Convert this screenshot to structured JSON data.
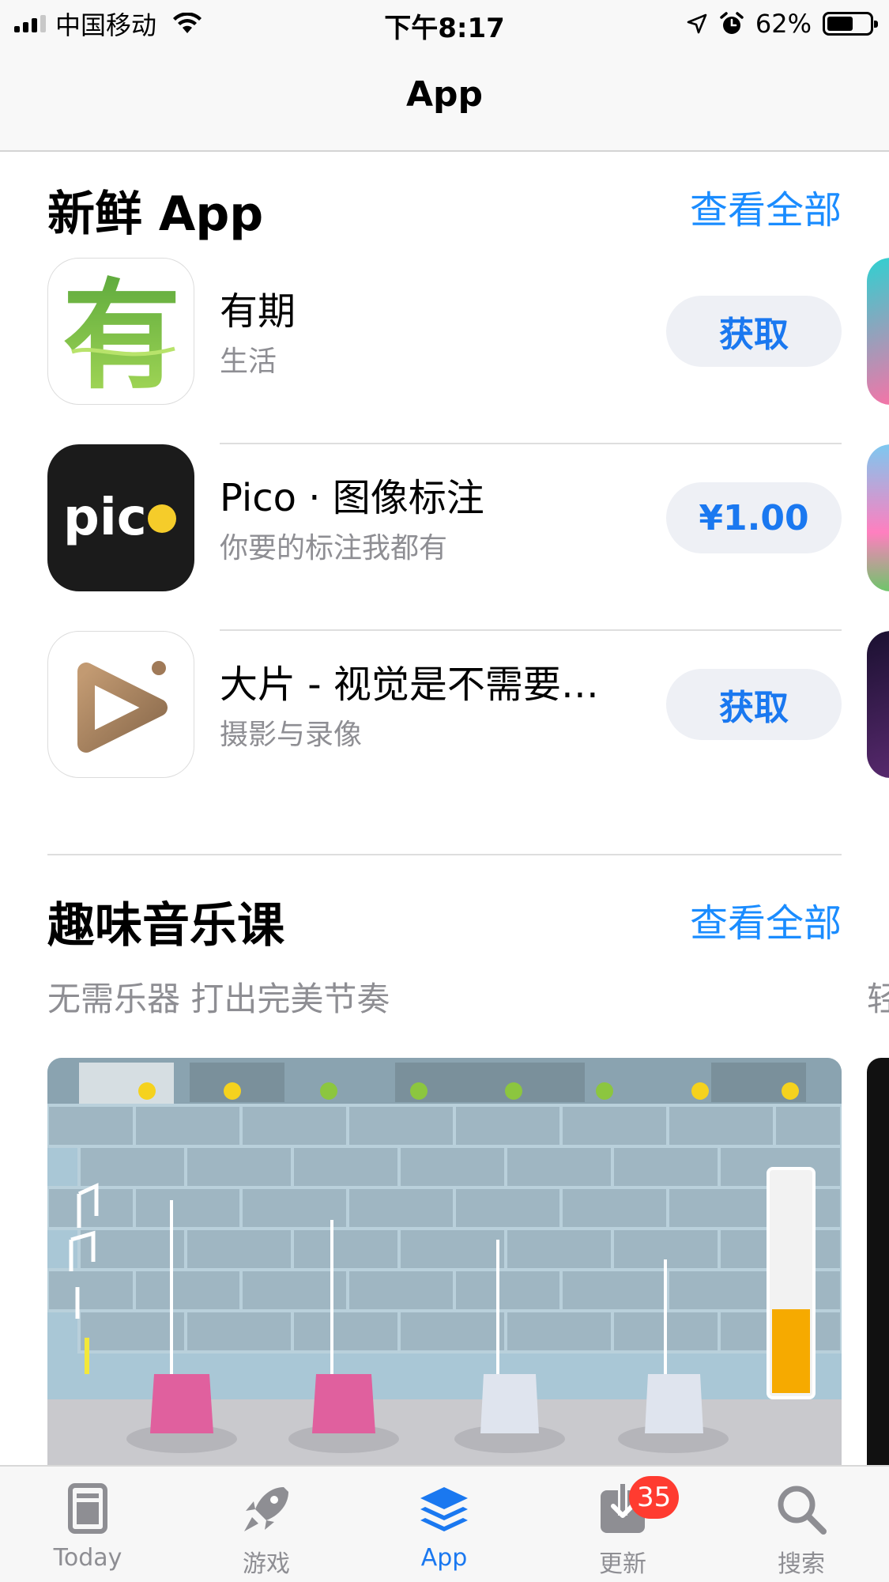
{
  "status_bar": {
    "carrier": "中国移动",
    "time": "下午8:17",
    "battery": "62%",
    "battery_level": 0.62
  },
  "nav": {
    "title": "App"
  },
  "section_new": {
    "title": "新鲜 App",
    "see_all": "查看全部",
    "apps": [
      {
        "name": "有期",
        "subtitle": "生活",
        "button": "获取",
        "icon_glyph": "有"
      },
      {
        "name": "Pico · 图像标注",
        "subtitle": "你要的标注我都有",
        "button": "¥1.00",
        "icon_text": "pic"
      },
      {
        "name": "大片 - 视觉是不需要…",
        "subtitle": "摄影与录像",
        "button": "获取"
      }
    ]
  },
  "section_music": {
    "title": "趣味音乐课",
    "see_all": "查看全部",
    "subtitle": "无需乐器 打出完美节奏",
    "next_peek": "轻"
  },
  "tab_bar": {
    "tabs": [
      {
        "label": "Today",
        "icon": "today-icon"
      },
      {
        "label": "游戏",
        "icon": "rocket-icon"
      },
      {
        "label": "App",
        "icon": "layers-icon"
      },
      {
        "label": "更新",
        "icon": "download-icon"
      },
      {
        "label": "搜索",
        "icon": "search-icon"
      }
    ],
    "active_index": 2,
    "updates_badge": "35"
  },
  "colors": {
    "accent": "#1a78f0",
    "badge": "#ff3b30",
    "secondary_text": "#8e8e93"
  }
}
